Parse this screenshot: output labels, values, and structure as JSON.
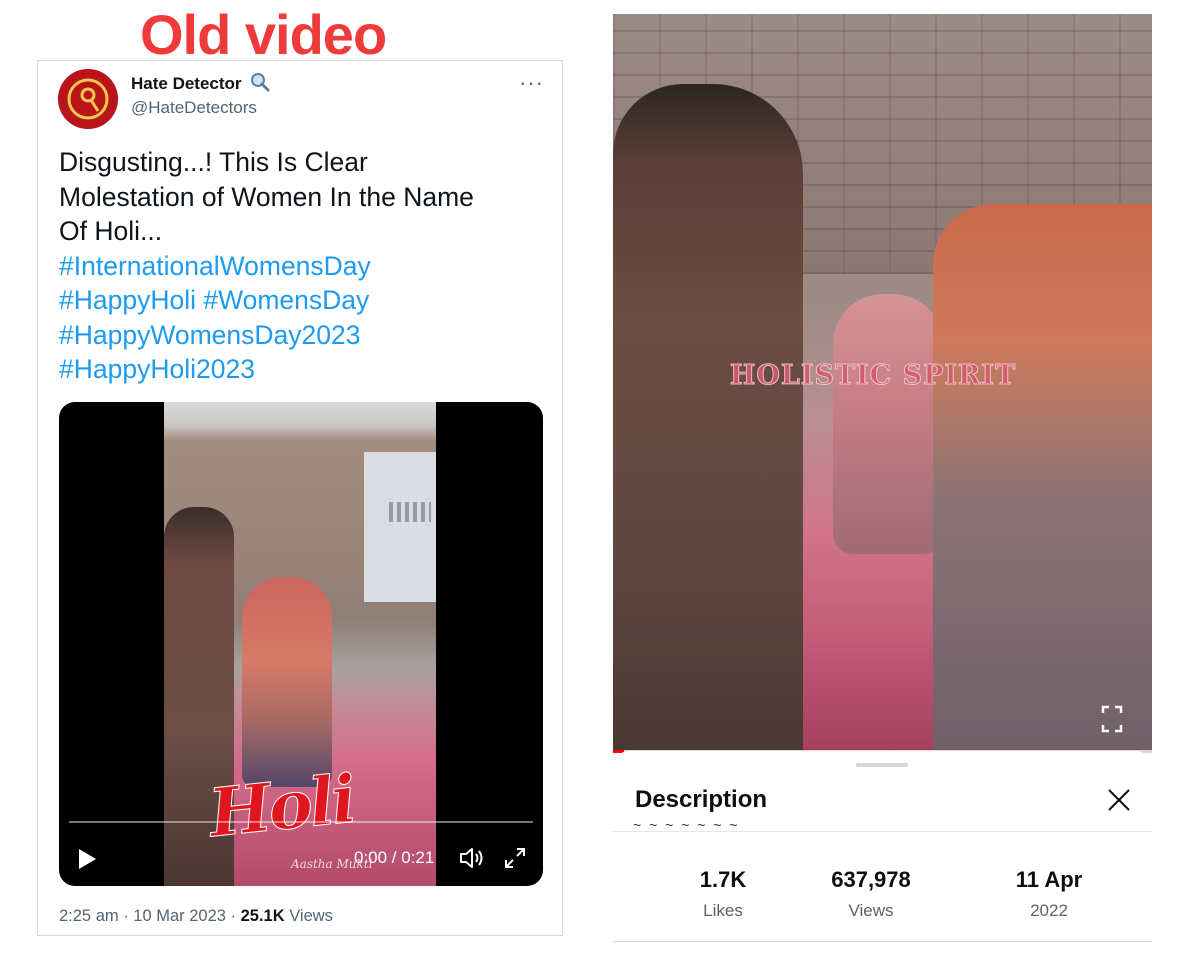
{
  "label": {
    "text": "Old video"
  },
  "tweet": {
    "author_name": "Hate Detector",
    "author_handle": "@HateDetectors",
    "more_icon": "ellipsis-icon",
    "text_lines": [
      "Disgusting...! This Is Clear",
      "Molestation of Women In the Name",
      "Of Holi..."
    ],
    "hashtag_lines": [
      "#InternationalWomensDay",
      "#HappyHoli #WomensDay",
      "#HappyWomensDay2023",
      "#HappyHoli2023"
    ],
    "video": {
      "overlay_title": "Holi",
      "overlay_subtitle": "Aastha Mukti",
      "time": "0:00 / 0:21"
    },
    "timestamp": "2:25 am · 10 Mar 2023 · ",
    "views_count": "25.1K",
    "views_label": " Views"
  },
  "youtube": {
    "watermark": "HOLISTIC SPIRIT",
    "progress": 0.02,
    "description_title": "Description",
    "cut_text": "~ ~ ~ ~ ~ ~ ~",
    "stats": [
      {
        "value": "1.7K",
        "label": "Likes"
      },
      {
        "value": "637,978",
        "label": "Views"
      },
      {
        "value": "11 Apr",
        "label": "2022"
      }
    ]
  },
  "colors": {
    "label_red": "#ee3a3a",
    "hashtag_blue": "#1d9bf0",
    "youtube_red": "#ff0000"
  }
}
